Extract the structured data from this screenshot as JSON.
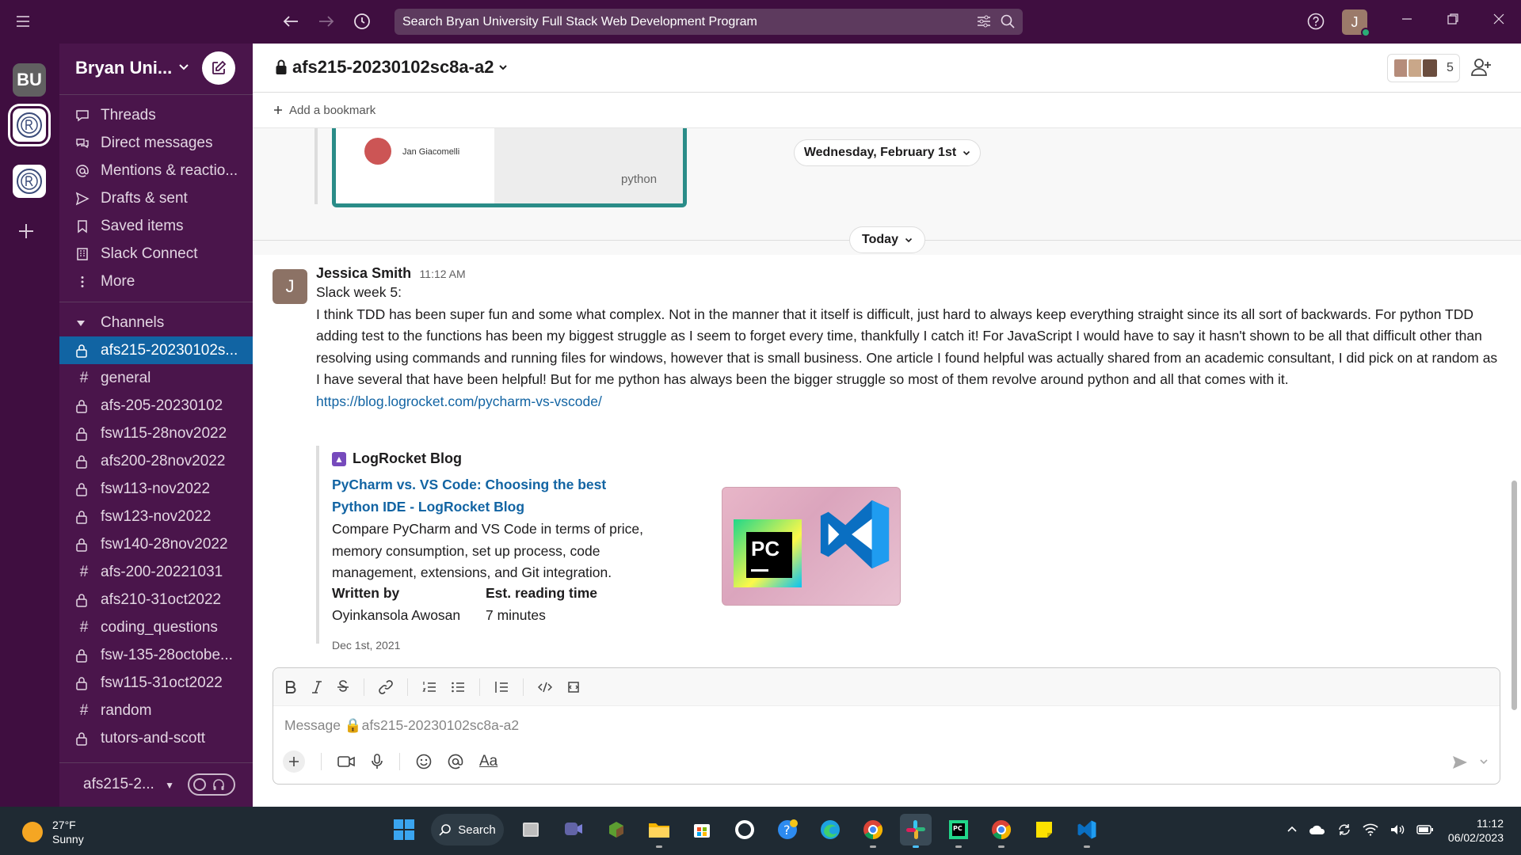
{
  "topbar": {
    "search_placeholder": "Search Bryan University Full Stack Web Development Program",
    "user_initial": "J"
  },
  "rail": {
    "workspace_initials": "BU"
  },
  "sidebar": {
    "workspace_name": "Bryan Uni...",
    "nav": [
      {
        "label": "Threads",
        "icon": "threads-icon"
      },
      {
        "label": "Direct messages",
        "icon": "direct-messages-icon"
      },
      {
        "label": "Mentions & reactio...",
        "icon": "at-icon"
      },
      {
        "label": "Drafts & sent",
        "icon": "send-icon"
      },
      {
        "label": "Saved items",
        "icon": "bookmark-icon"
      },
      {
        "label": "Slack Connect",
        "icon": "building-icon"
      },
      {
        "label": "More",
        "icon": "more-icon"
      }
    ],
    "channels_label": "Channels",
    "channels": [
      {
        "name": "afs215-20230102s...",
        "type": "private",
        "active": true
      },
      {
        "name": "general",
        "type": "public"
      },
      {
        "name": "afs-205-20230102",
        "type": "private"
      },
      {
        "name": "fsw115-28nov2022",
        "type": "private"
      },
      {
        "name": "afs200-28nov2022",
        "type": "private"
      },
      {
        "name": "fsw113-nov2022",
        "type": "private"
      },
      {
        "name": "fsw123-nov2022",
        "type": "private"
      },
      {
        "name": "fsw140-28nov2022",
        "type": "private"
      },
      {
        "name": "afs-200-20221031",
        "type": "public"
      },
      {
        "name": "afs210-31oct2022",
        "type": "private"
      },
      {
        "name": "coding_questions",
        "type": "public"
      },
      {
        "name": "fsw-135-28octobe...",
        "type": "private"
      },
      {
        "name": "fsw115-31oct2022",
        "type": "private"
      },
      {
        "name": "random",
        "type": "public"
      },
      {
        "name": "tutors-and-scott",
        "type": "private"
      }
    ],
    "footer_channel": "afs215-2..."
  },
  "channel": {
    "name": "afs215-20230102sc8a-a2",
    "member_count": "5",
    "add_bookmark": "Add a bookmark"
  },
  "history": {
    "preview_author": "Jan Giacomelli",
    "preview_logo": "python",
    "date_divider": "Wednesday, February 1st",
    "today_divider": "Today"
  },
  "message": {
    "author": "Jessica Smith",
    "initial": "J",
    "time": "11:12 AM",
    "line1": "Slack week 5:",
    "body": "I think TDD has been super fun and some what complex. Not in the manner that it itself is difficult, just hard to always keep everything straight since its all sort of backwards. For python TDD adding test to the functions has been my biggest struggle as I seem to forget every time, thankfully I catch it! For JavaScript I would have to say it hasn't shown to be all that difficult other than resolving using commands and running files for windows, however that is small business. One article I found helpful was actually shared from an academic consultant, I did pick on at random as I have several that have been helpful! But for me python has always been the bigger struggle so most of them revolve around python and all that comes with it.",
    "link": "https://blog.logrocket.com/pycharm-vs-vscode/"
  },
  "unfurl": {
    "site": "LogRocket Blog",
    "title": "PyCharm vs. VS Code: Choosing the best Python IDE - LogRocket Blog",
    "description": "Compare PyCharm and VS Code in terms of price, memory consumption, set up process, code management, extensions, and Git integration.",
    "written_by_label": "Written by",
    "written_by": "Oyinkansola Awosan",
    "reading_label": "Est. reading time",
    "reading_time": "7 minutes",
    "date": "Dec 1st, 2021",
    "image_text": "PC"
  },
  "composer": {
    "placeholder": "Message 🔒afs215-20230102sc8a-a2",
    "text_format_label": "Aa"
  },
  "taskbar": {
    "temperature": "27°F",
    "condition": "Sunny",
    "search_label": "Search",
    "time": "11:12",
    "date": "06/02/2023"
  },
  "colors": {
    "sidebar": "#4a154b",
    "topbar": "#3f0e40",
    "active_channel": "#1164a3",
    "link": "#1264a3"
  }
}
